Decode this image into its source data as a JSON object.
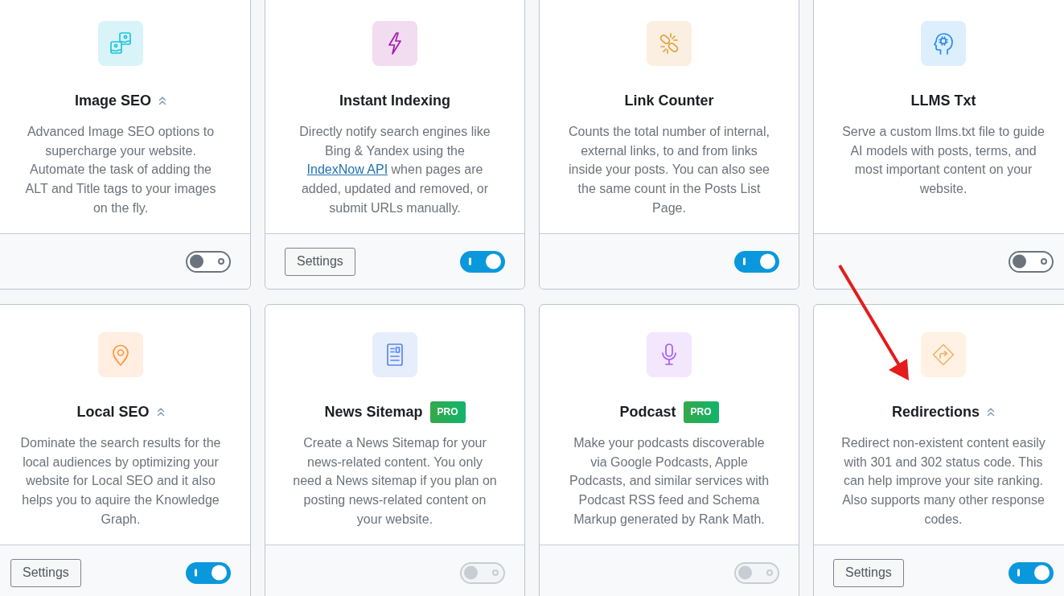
{
  "cards": [
    {
      "title": "Image SEO",
      "double_chevron": true,
      "description": [
        {
          "kind": "text",
          "text": "Advanced Image SEO options to supercharge your website.\nAutomate the task of adding the ALT and Title tags to your images on the fly."
        }
      ],
      "toggle": {
        "on": false,
        "disabled": false
      },
      "arrow": false
    },
    {
      "title": "Instant Indexing",
      "double_chevron": false,
      "description": [
        {
          "kind": "text",
          "text": "Directly notify search engines like Bing & Yandex using the "
        },
        {
          "kind": "link",
          "text": "IndexNow API"
        },
        {
          "kind": "text",
          "text": " when pages are added, updated and removed, or submit URLs manually."
        }
      ],
      "settings_button": "Settings",
      "toggle": {
        "on": true,
        "disabled": false
      },
      "arrow": false
    },
    {
      "title": "Link Counter",
      "double_chevron": false,
      "description": [
        {
          "kind": "text",
          "text": "Counts the total number of internal, external links, to and from links inside your posts. You can also see the same count in the Posts List Page."
        }
      ],
      "toggle": {
        "on": true,
        "disabled": false
      },
      "arrow": false
    },
    {
      "title": "LLMS Txt",
      "double_chevron": false,
      "description": [
        {
          "kind": "text",
          "text": "Serve a custom llms.txt file to guide AI models with posts, terms, and most important content on your website."
        }
      ],
      "toggle": {
        "on": false,
        "disabled": false
      },
      "arrow": false
    },
    {
      "title": "Local SEO",
      "double_chevron": true,
      "description": [
        {
          "kind": "text",
          "text": "Dominate the search results for the local audiences by optimizing your website for Local SEO and it also helps you to aquire the Knowledge Graph."
        }
      ],
      "settings_button": "Settings",
      "toggle": {
        "on": true,
        "disabled": false
      },
      "arrow": false
    },
    {
      "title": "News Sitemap",
      "double_chevron": false,
      "badge": "PRO",
      "description": [
        {
          "kind": "text",
          "text": "Create a News Sitemap for your news-related content. You only need a News sitemap if you plan on posting news-related content on your website."
        }
      ],
      "toggle": {
        "on": false,
        "disabled": true
      },
      "arrow": false
    },
    {
      "title": "Podcast",
      "double_chevron": false,
      "badge": "PRO",
      "description": [
        {
          "kind": "text",
          "text": "Make your podcasts discoverable via Google Podcasts, Apple Podcasts, and similar services with Podcast RSS feed and Schema Markup generated by Rank Math."
        }
      ],
      "toggle": {
        "on": false,
        "disabled": true
      },
      "arrow": false
    },
    {
      "title": "Redirections",
      "double_chevron": true,
      "description": [
        {
          "kind": "text",
          "text": "Redirect non-existent content easily with 301 and 302 status code. This can help improve your site ranking. Also supports many other response codes."
        }
      ],
      "settings_button": "Settings",
      "toggle": {
        "on": true,
        "disabled": false
      },
      "arrow": true
    }
  ]
}
